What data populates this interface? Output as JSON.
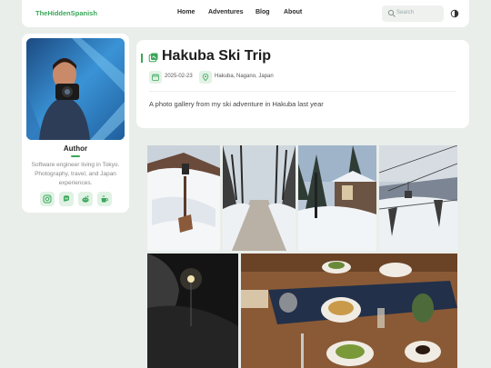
{
  "header": {
    "brand": "TheHiddenSpanish",
    "nav": [
      {
        "label": "Home"
      },
      {
        "label": "Adventures"
      },
      {
        "label": "Blog"
      },
      {
        "label": "About"
      }
    ],
    "search": {
      "placeholder": "Search",
      "icon": "search-icon"
    },
    "theme_toggle_icon": "theme-toggle-icon"
  },
  "sidebar": {
    "avatar_alt": "Author photo",
    "name": "Author",
    "bio": "Software engineer living in Tokyo. Photography, travel, and Japan experiences.",
    "socials": [
      {
        "name": "instagram-icon"
      },
      {
        "name": "mastodon-icon"
      },
      {
        "name": "reddit-icon"
      },
      {
        "name": "coffee-icon"
      }
    ]
  },
  "post": {
    "title": "Hakuba Ski Trip",
    "date": "2025-02-23",
    "location": "Hakuba, Nagano, Japan",
    "description": "A photo gallery from my ski adventure in Hakuba last year"
  },
  "gallery": {
    "photos": [
      {
        "name": "photo-snow-roof"
      },
      {
        "name": "photo-snowy-path"
      },
      {
        "name": "photo-snow-house"
      },
      {
        "name": "photo-ski-lift"
      },
      {
        "name": "photo-night-snow"
      },
      {
        "name": "photo-dinner-table"
      }
    ]
  },
  "colors": {
    "accent": "#3aa65a",
    "background": "#e9eeea",
    "card": "#ffffff"
  }
}
